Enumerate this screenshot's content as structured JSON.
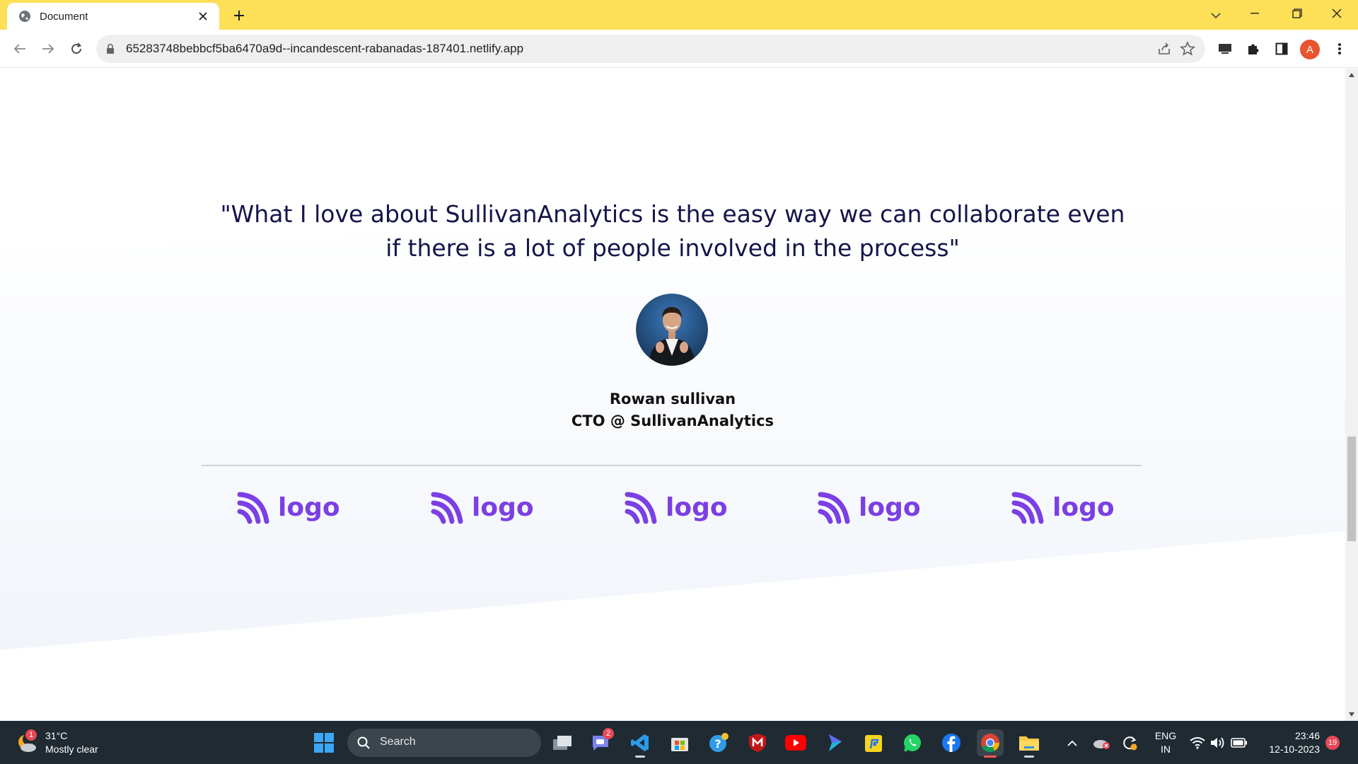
{
  "browser": {
    "tab_title": "Document",
    "url": "65283748bebbcf5ba6470a9d--incandescent-rabanadas-187401.netlify.app",
    "profile_initial": "A",
    "theme_color": "#fddf58"
  },
  "page": {
    "quote": "\"What I love about SullivanAnalytics is the easy way we can collaborate even if there is a lot of people involved in the process\"",
    "person_name": "Rowan sullivan",
    "person_title": "CTO @ SullivanAnalytics",
    "logos": [
      {
        "text": "logo"
      },
      {
        "text": "logo"
      },
      {
        "text": "logo"
      },
      {
        "text": "logo"
      },
      {
        "text": "logo"
      }
    ],
    "logo_color": "#7b3fe4",
    "text_color": "#16144a"
  },
  "taskbar": {
    "weather_temp": "31°C",
    "weather_condition": "Mostly clear",
    "weather_badge": "1",
    "search_placeholder": "Search",
    "teams_badge": "2",
    "language_line1": "ENG",
    "language_line2": "IN",
    "time": "23:46",
    "date": "12-10-2023",
    "notification_count": "19"
  }
}
